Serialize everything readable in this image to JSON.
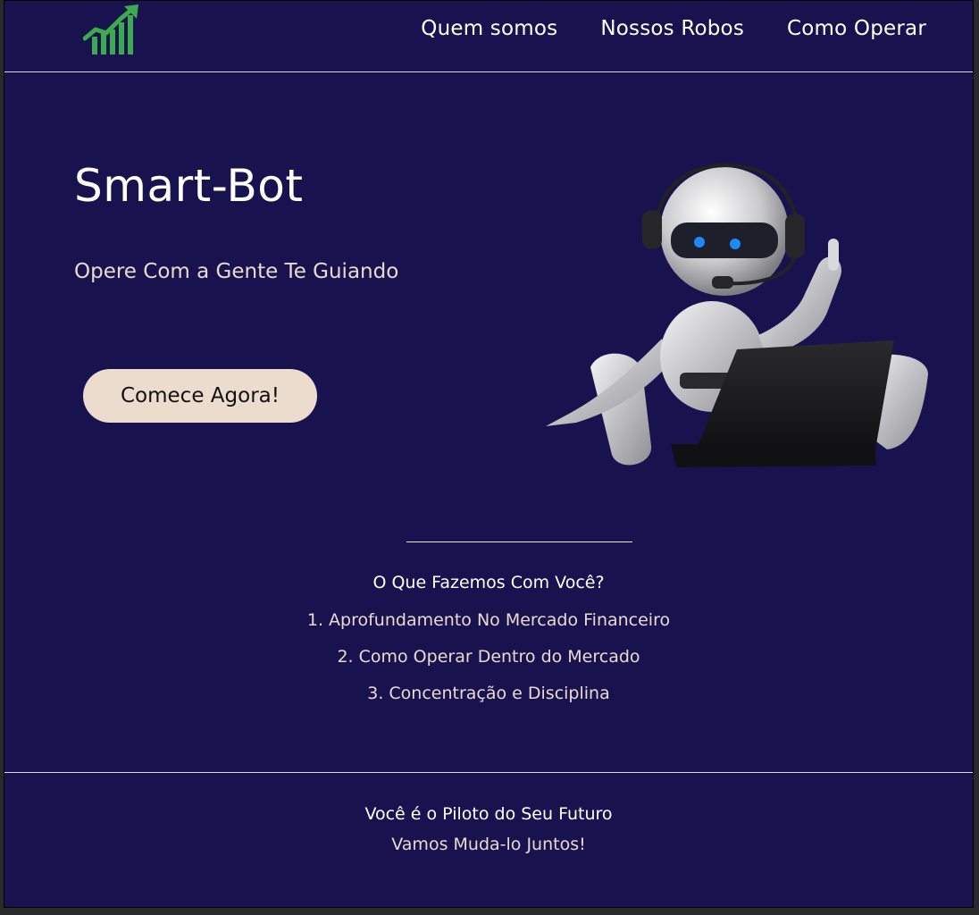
{
  "colors": {
    "background": "#18134f",
    "accent_green": "#3caa4f",
    "cta_bg": "#ecdccd",
    "text_white": "#ffffff",
    "text_cream": "#ead9cf"
  },
  "header": {
    "logo_icon": "chart-growth-icon",
    "nav": [
      {
        "label": "Quem somos"
      },
      {
        "label": "Nossos Robos"
      },
      {
        "label": "Como Operar"
      }
    ]
  },
  "hero": {
    "title": "Smart-Bot",
    "subtitle": "Opere Com a Gente Te Guiando",
    "cta_label": "Comece Agora!",
    "image_icon": "robot-with-laptop-image"
  },
  "what": {
    "title": "O Que Fazemos Com Você?",
    "items": [
      "1. Aprofundamento No Mercado Financeiro",
      "2. Como Operar Dentro do Mercado",
      "3. Concentração e Disciplina"
    ]
  },
  "footer": {
    "line1": "Você é o Piloto do Seu Futuro",
    "line2": "Vamos Muda-lo Juntos!"
  }
}
